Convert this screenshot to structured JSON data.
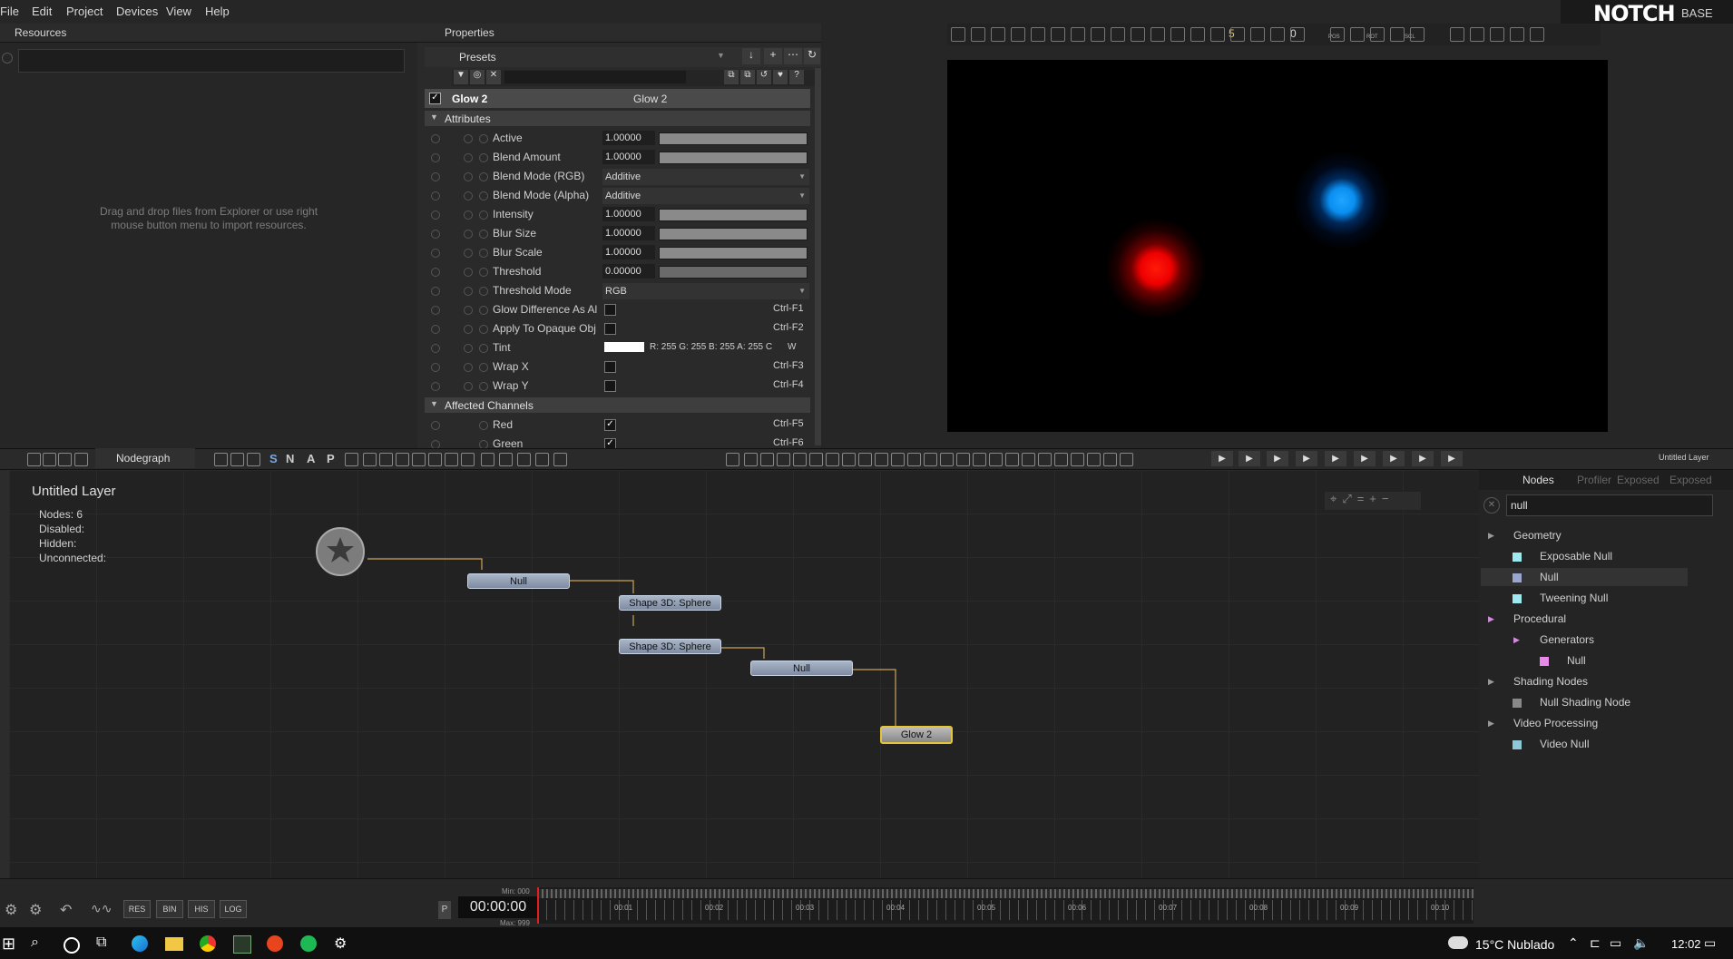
{
  "menu": {
    "file": "File",
    "edit": "Edit",
    "project": "Project",
    "devices": "Devices",
    "view": "View",
    "help": "Help"
  },
  "brand": {
    "name": "NOTCH",
    "edition": "BASE"
  },
  "resources": {
    "title": "Resources",
    "hint": "Drag and drop files from Explorer or use right mouse button menu to import resources."
  },
  "properties": {
    "title": "Properties",
    "presets_label": "Presets",
    "node_name": "Glow 2",
    "node_type": "Glow 2",
    "section_attributes": "Attributes",
    "section_channels": "Affected Channels",
    "rows": [
      {
        "label": "Active",
        "value": "1.00000",
        "fill": 1.0
      },
      {
        "label": "Blend Amount",
        "value": "1.00000",
        "fill": 1.0
      },
      {
        "label": "Blend Mode (RGB)",
        "dropdown": "Additive"
      },
      {
        "label": "Blend Mode (Alpha)",
        "dropdown": "Additive"
      },
      {
        "label": "Intensity",
        "value": "1.00000",
        "fill": 1.0
      },
      {
        "label": "Blur Size",
        "value": "1.00000",
        "fill": 1.0
      },
      {
        "label": "Blur Scale",
        "value": "1.00000",
        "fill": 1.0
      },
      {
        "label": "Threshold",
        "value": "0.00000",
        "fill": 0.0
      },
      {
        "label": "Threshold Mode",
        "dropdown": "RGB"
      },
      {
        "label": "Glow Difference As Al",
        "check": false,
        "shortcut": "Ctrl-F1"
      },
      {
        "label": "Apply To Opaque Obj",
        "check": false,
        "shortcut": "Ctrl-F2"
      },
      {
        "label": "Tint",
        "tint": "R: 255 G: 255 B: 255 A: 255 C",
        "tint_extra": "W"
      },
      {
        "label": "Wrap X",
        "check": false,
        "shortcut": "Ctrl-F3"
      },
      {
        "label": "Wrap Y",
        "check": false,
        "shortcut": "Ctrl-F4"
      }
    ],
    "channel_rows": [
      {
        "label": "Red",
        "check": true,
        "shortcut": "Ctrl-F5"
      },
      {
        "label": "Green",
        "check": true,
        "shortcut": "Ctrl-F6"
      }
    ]
  },
  "viewport": {
    "toolbar_numbers": [
      "5",
      "0"
    ],
    "toolbar_labels": [
      "POS",
      "ROT",
      "SCL"
    ],
    "layer_label": "Untitled Layer"
  },
  "nodegraph": {
    "tab": "Nodegraph",
    "toolbar_letters": [
      "S",
      "N",
      "A",
      "P"
    ],
    "layer_title": "Untitled  Layer",
    "stats": {
      "nodes": "Nodes:  6",
      "disabled": "Disabled:",
      "hidden": "Hidden:",
      "unconnected": "Unconnected:"
    },
    "nodes": [
      "Null",
      "Shape 3D:  Sphere",
      "Shape 3D:  Sphere",
      "Null",
      "Glow  2"
    ]
  },
  "nodes_panel": {
    "tabs": [
      "Nodes",
      "Profiler",
      "Exposed",
      "Exposed"
    ],
    "search": "null",
    "items": [
      {
        "label": "Geometry",
        "level": 0
      },
      {
        "label": "Exposable Null",
        "level": 1,
        "color": "#9ee8f0"
      },
      {
        "label": "Null",
        "level": 1,
        "color": "#9aa6d0"
      },
      {
        "label": "Tweening Null",
        "level": 1,
        "color": "#9ee8f0"
      },
      {
        "label": "Procedural",
        "level": 0
      },
      {
        "label": "Generators",
        "level": 1
      },
      {
        "label": "Null",
        "level": 2,
        "color": "#e58ae8"
      },
      {
        "label": "Shading Nodes",
        "level": 0
      },
      {
        "label": "Null Shading Node",
        "level": 1,
        "color": "#888888"
      },
      {
        "label": "Video Processing",
        "level": 0
      },
      {
        "label": "Video Null",
        "level": 1,
        "color": "#8ec8d6"
      }
    ]
  },
  "bottom": {
    "buttons": [
      "RES",
      "BIN",
      "HIS",
      "LOG"
    ],
    "timecode": "00:00:00",
    "min": "Min: 000",
    "max": "Max: 999",
    "p": "P",
    "ticks": [
      "00:01",
      "00:02",
      "00:03",
      "00:04",
      "00:05",
      "00:06",
      "00:07",
      "00:08",
      "00:09",
      "00:10"
    ]
  },
  "taskbar": {
    "weather": "15°C  Nublado",
    "time": "12:02"
  }
}
